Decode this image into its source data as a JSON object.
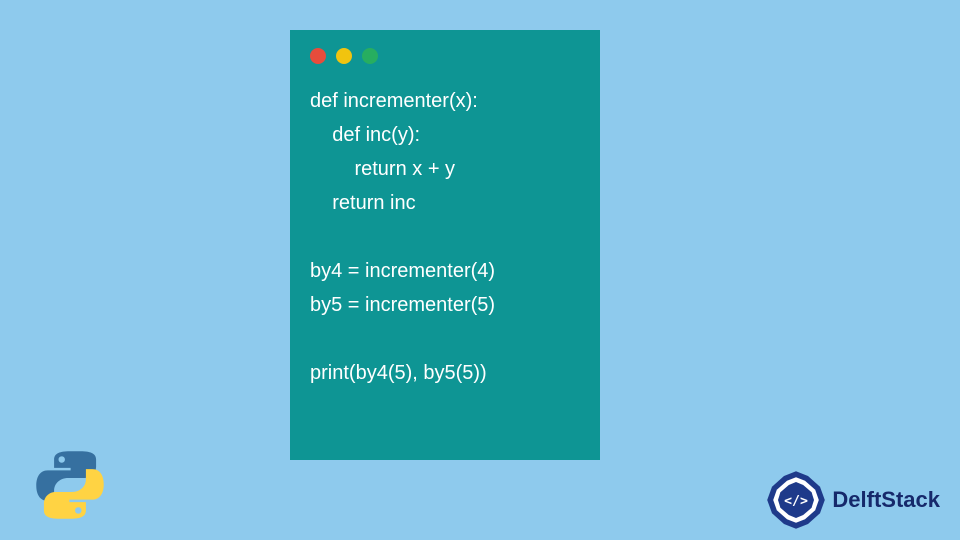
{
  "code": {
    "line1": "def incrementer(x):",
    "line2": "    def inc(y):",
    "line3": "        return x + y",
    "line4": "    return inc",
    "line5": "",
    "line6": "by4 = incrementer(4)",
    "line7": "by5 = incrementer(5)",
    "line8": "",
    "line9": "print(by4(5), by5(5))"
  },
  "brand": {
    "name": "DelftStack"
  },
  "colors": {
    "page_bg": "#8ecaed",
    "window_bg": "#0e9594",
    "dot_red": "#e74c3c",
    "dot_yellow": "#f1c40f",
    "dot_green": "#27ae60",
    "brand_blue": "#16296b"
  }
}
